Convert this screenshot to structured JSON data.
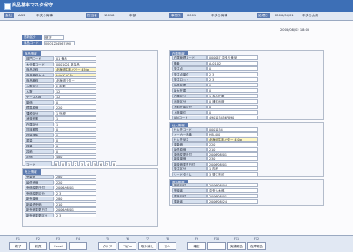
{
  "window": {
    "title": "商品基本マスタ保守"
  },
  "toolbar": [
    {
      "label": "会社",
      "value": "AG3",
      "extra": "中央ら商事"
    },
    {
      "label": "担当者",
      "value": "10018",
      "extra": "本部"
    },
    {
      "label": "事業所",
      "value": "0001",
      "extra": "中央ら商事"
    },
    {
      "label": "処理日",
      "value": "2006/06/01",
      "extra": "中央ら太郎"
    }
  ],
  "datestamp": "2006/08/02 18:05",
  "header": {
    "key_label": "更新区分",
    "key_value": "修正",
    "sub_label": "商品コード",
    "sub_value": "0001234567890"
  },
  "sections": {
    "product": "商品情報",
    "sales": "売上情報",
    "stock": "在庫情報",
    "supply": "仕入情報",
    "history": "更新履歴"
  },
  "product_fields": [
    {
      "label": "部門コード",
      "value": "01   食品"
    },
    {
      "label": "大分類コード",
      "value": "0001001   乳製品"
    },
    {
      "label": "商品名称",
      "value": "北海道牛乳バター  450g",
      "highlight": true
    },
    {
      "label": "商品略称カナ",
      "value": "ﾎｯｶｲﾄﾞｳﾊﾞﾀｰ",
      "highlight": true
    },
    {
      "label": "商品略称",
      "value": "北海道バター"
    },
    {
      "label": "入数区分",
      "value": "2   本数"
    },
    {
      "label": "入数",
      "value": "12"
    },
    {
      "label": "ケース入数",
      "value": "12"
    },
    {
      "label": "単価",
      "value": "0"
    },
    {
      "label": "標準原価",
      "value": "220"
    },
    {
      "label": "課税区分",
      "value": "1   外税"
    },
    {
      "label": "消費税率",
      "value": "1"
    },
    {
      "label": "在庫区分",
      "value": "1"
    },
    {
      "label": "賞味期限",
      "value": "0"
    },
    {
      "label": "保管場所",
      "value": "0"
    },
    {
      "label": "重量",
      "value": "0"
    },
    {
      "label": "容量",
      "value": "0"
    },
    {
      "label": "容積",
      "value": "0"
    },
    {
      "label": "定価",
      "value": "480"
    }
  ],
  "pattern_label": "コード",
  "pattern": [
    "8",
    "0",
    "1",
    "2",
    "3",
    "4",
    "5",
    "6",
    "7",
    "8"
  ],
  "sales_fields": [
    {
      "label": "売単価",
      "value": "280"
    },
    {
      "label": "最低売価",
      "value": "220"
    },
    {
      "label": "売価変更日付",
      "value": "2006/08/01"
    },
    {
      "label": "売価変更区分",
      "value": "2   3"
    },
    {
      "label": "新売単価",
      "value": "280"
    },
    {
      "label": "新最低売価",
      "value": "210"
    },
    {
      "label": "新売価変更日付",
      "value": "2006/08/01"
    },
    {
      "label": "新売価変更区分",
      "value": "2   3"
    }
  ],
  "stock_fields": [
    {
      "label": "在庫管理コード",
      "value": "000067   中央ら食品"
    },
    {
      "label": "棚番",
      "value": "A-01-02"
    },
    {
      "label": "発注点",
      "value": "0"
    },
    {
      "label": "発注点単位",
      "value": "2   3"
    },
    {
      "label": "発注ロット",
      "value": "2   3"
    },
    {
      "label": "最低在庫",
      "value": "0"
    },
    {
      "label": "最大在庫",
      "value": "0"
    },
    {
      "label": "在庫区分",
      "value": "1   食品在庫"
    },
    {
      "label": "出荷区分",
      "value": "0   通常出荷"
    },
    {
      "label": "不動在庫区分",
      "value": "0"
    },
    {
      "label": "入荷単位",
      "value": "0"
    },
    {
      "label": "JANコード",
      "value": "4901234567890"
    }
  ],
  "supply_fields": [
    {
      "label": "仕入先コード",
      "value": "0001234"
    },
    {
      "label": "メーカー品番",
      "value": "HB-450"
    },
    {
      "label": "仕入先品名",
      "value": "北海道牛乳バター  450g",
      "highlight": true
    },
    {
      "label": "原単価",
      "value": "220"
    },
    {
      "label": "最低原価",
      "value": "210"
    },
    {
      "label": "原価変更日付",
      "value": "2006/08/01"
    },
    {
      "label": "新原単価",
      "value": "230"
    },
    {
      "label": "新原価変更日付",
      "value": "2006/08/01"
    },
    {
      "label": "発注区分",
      "value": "1   内税"
    },
    {
      "label": "リードタイム",
      "value": "3   発注不可"
    }
  ],
  "history_fields": [
    {
      "label": "登録日付",
      "value": "2006/08/04"
    },
    {
      "label": "登録者",
      "value": "中央ら太郎"
    },
    {
      "label": "更新日付",
      "value": "2006/08/01"
    },
    {
      "label": "更新者",
      "value": "2006/08/24"
    }
  ],
  "function_keys": [
    {
      "key": "F1",
      "label": "終了"
    },
    {
      "key": "F2",
      "label": "前頁"
    },
    {
      "key": "F3",
      "label": "Excel"
    },
    {
      "key": "F4",
      "label": ""
    },
    {
      "key": "F5",
      "label": "クリア"
    },
    {
      "key": "F6",
      "label": "コピー"
    },
    {
      "key": "F7",
      "label": "取り消し"
    },
    {
      "key": "F8",
      "label": "次へ"
    },
    {
      "key": "F9",
      "label": "確定"
    },
    {
      "key": "F10",
      "label": ""
    },
    {
      "key": "F11",
      "label": "実績照会"
    },
    {
      "key": "F12",
      "label": "在庫照会"
    }
  ]
}
